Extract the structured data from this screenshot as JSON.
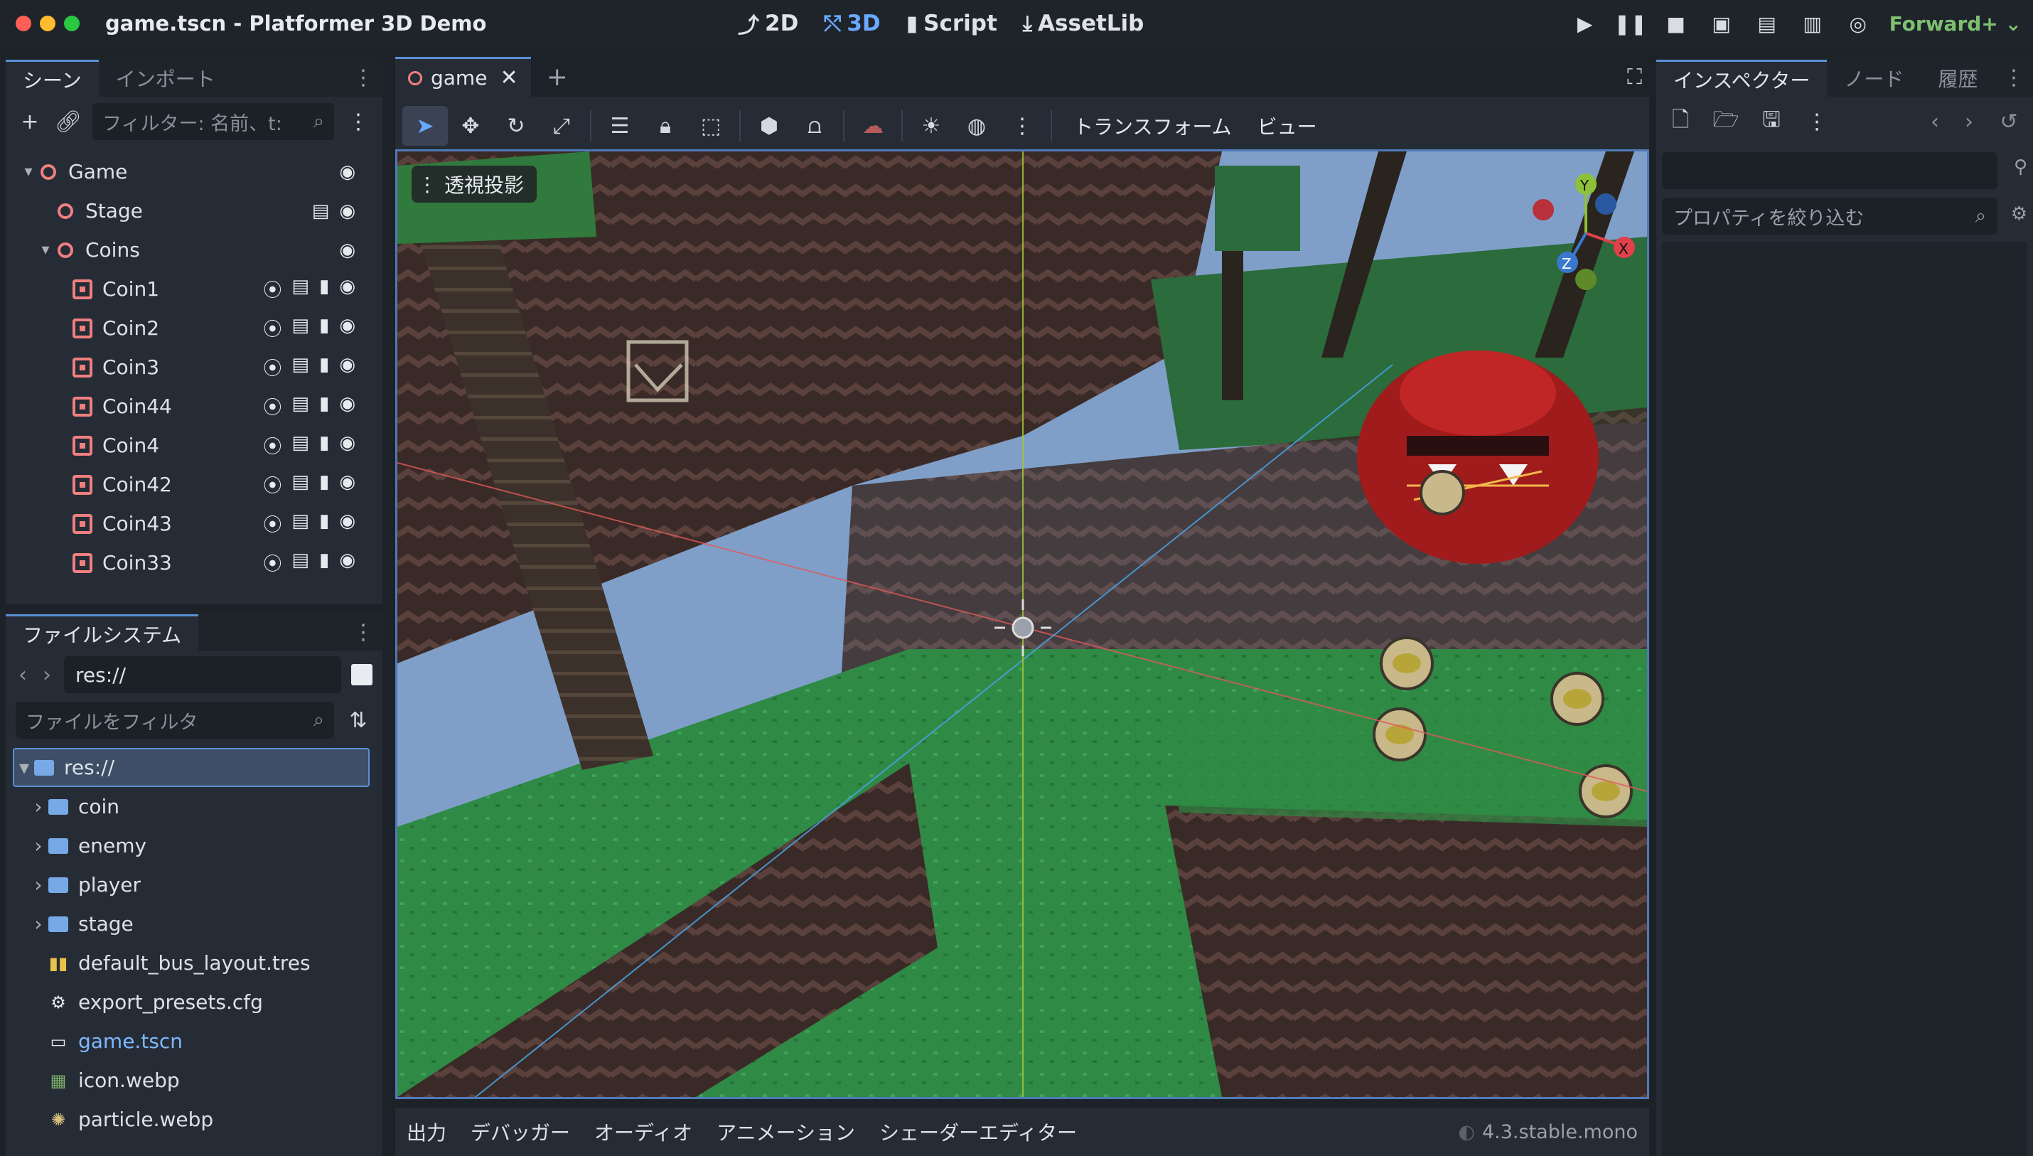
{
  "window": {
    "title": "game.tscn - Platformer 3D Demo",
    "dots": [
      "#ff5f57",
      "#febc2e",
      "#28c840"
    ]
  },
  "modes": [
    {
      "label": "2D",
      "icon": "2d-icon",
      "active": false
    },
    {
      "label": "3D",
      "icon": "3d-icon",
      "active": true
    },
    {
      "label": "Script",
      "icon": "script-icon",
      "active": false
    },
    {
      "label": "AssetLib",
      "icon": "assetlib-icon",
      "active": false
    }
  ],
  "renderer": "Forward+",
  "scene_panel": {
    "tabs": [
      "シーン",
      "インポート"
    ],
    "filter_placeholder": "フィルター: 名前、t:",
    "tree": [
      {
        "name": "Game",
        "depth": 0,
        "arrow": "▾",
        "kind": "ring"
      },
      {
        "name": "Stage",
        "depth": 1,
        "arrow": "",
        "kind": "ring",
        "icons": [
          "clapper-icon",
          "eye-icon"
        ]
      },
      {
        "name": "Coins",
        "depth": 1,
        "arrow": "▾",
        "kind": "ring"
      },
      {
        "name": "Coin1",
        "depth": 2,
        "arrow": "",
        "kind": "area"
      },
      {
        "name": "Coin2",
        "depth": 2,
        "arrow": "",
        "kind": "area"
      },
      {
        "name": "Coin3",
        "depth": 2,
        "arrow": "",
        "kind": "area"
      },
      {
        "name": "Coin44",
        "depth": 2,
        "arrow": "",
        "kind": "area"
      },
      {
        "name": "Coin4",
        "depth": 2,
        "arrow": "",
        "kind": "area"
      },
      {
        "name": "Coin42",
        "depth": 2,
        "arrow": "",
        "kind": "area"
      },
      {
        "name": "Coin43",
        "depth": 2,
        "arrow": "",
        "kind": "area"
      },
      {
        "name": "Coin33",
        "depth": 2,
        "arrow": "",
        "kind": "area"
      }
    ]
  },
  "filesystem": {
    "tab": "ファイルシステム",
    "path": "res://",
    "filter_placeholder": "ファイルをフィルタ",
    "items": [
      {
        "name": "res://",
        "type": "folder",
        "depth": 0,
        "arrow": "▾",
        "selected": true
      },
      {
        "name": "coin",
        "type": "folder",
        "depth": 1,
        "arrow": "›"
      },
      {
        "name": "enemy",
        "type": "folder",
        "depth": 1,
        "arrow": "›"
      },
      {
        "name": "player",
        "type": "folder",
        "depth": 1,
        "arrow": "›"
      },
      {
        "name": "stage",
        "type": "folder",
        "depth": 1,
        "arrow": "›"
      },
      {
        "name": "default_bus_layout.tres",
        "type": "bus",
        "depth": 1,
        "arrow": ""
      },
      {
        "name": "export_presets.cfg",
        "type": "cfg",
        "depth": 1,
        "arrow": ""
      },
      {
        "name": "game.tscn",
        "type": "scene",
        "depth": 1,
        "arrow": "",
        "highlight": true
      },
      {
        "name": "icon.webp",
        "type": "image",
        "depth": 1,
        "arrow": ""
      },
      {
        "name": "particle.webp",
        "type": "image2",
        "depth": 1,
        "arrow": ""
      }
    ]
  },
  "editor": {
    "doc_tab": "game",
    "add_tab": "+",
    "menus": [
      "トランスフォーム",
      "ビュー"
    ],
    "perspective_label": "透視投影",
    "gizmo": {
      "x": "X",
      "y": "Y",
      "z": "Z"
    }
  },
  "bottom_tabs": [
    "出力",
    "デバッガー",
    "オーディオ",
    "アニメーション",
    "シェーダーエディター"
  ],
  "version": "4.3.stable.mono",
  "inspector": {
    "tabs": [
      "インスペクター",
      "ノード",
      "履歴"
    ],
    "filter_placeholder": "プロパティを絞り込む"
  }
}
